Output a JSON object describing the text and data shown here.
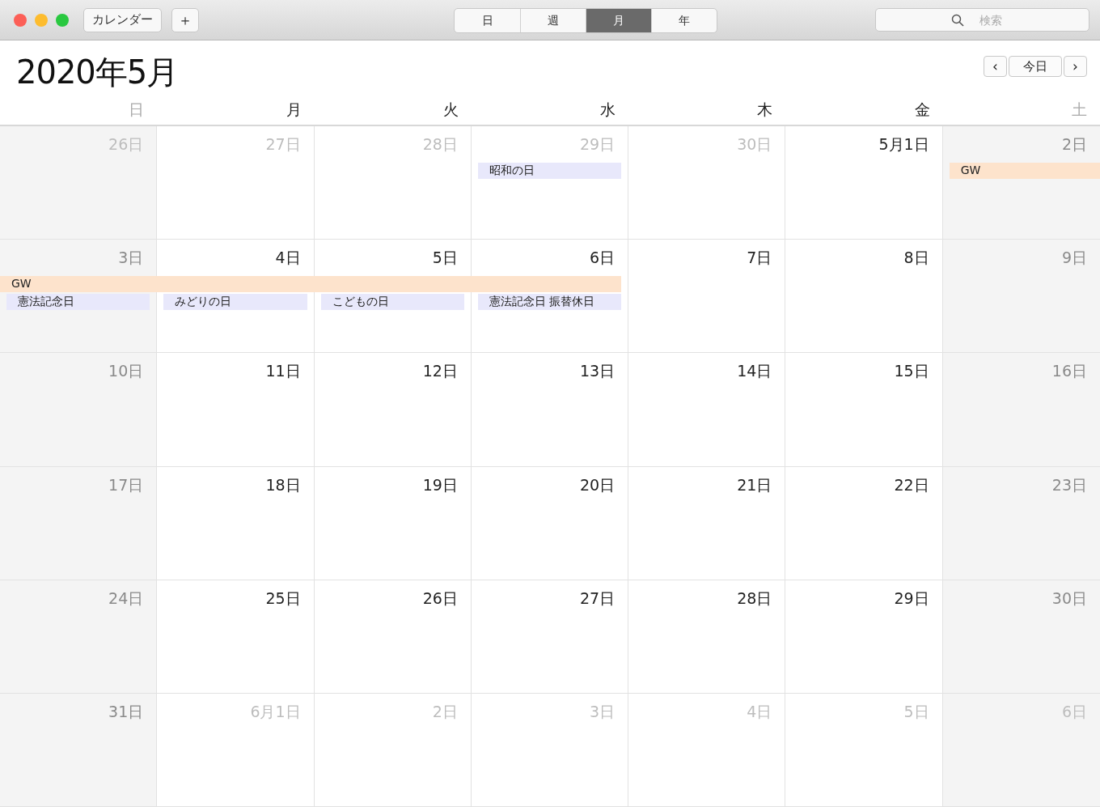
{
  "toolbar": {
    "calendars_button": "カレンダー",
    "add_button": "＋",
    "views": [
      {
        "label": "日",
        "selected": false
      },
      {
        "label": "週",
        "selected": false
      },
      {
        "label": "月",
        "selected": true
      },
      {
        "label": "年",
        "selected": false
      }
    ],
    "search": {
      "placeholder": "検索"
    }
  },
  "title": "2020年5月",
  "nav": {
    "prev": "‹",
    "today": "今日",
    "next": "›"
  },
  "weekdays": [
    "日",
    "月",
    "火",
    "水",
    "木",
    "金",
    "土"
  ],
  "weeks": [
    {
      "days": [
        {
          "label": "26日",
          "in_month": false
        },
        {
          "label": "27日",
          "in_month": false
        },
        {
          "label": "28日",
          "in_month": false
        },
        {
          "label": "29日",
          "in_month": false,
          "events": [
            {
              "kind": "single",
              "title": "昭和の日",
              "color": "#e8e8fb"
            }
          ]
        },
        {
          "label": "30日",
          "in_month": false
        },
        {
          "label": "5月1日",
          "in_month": true
        },
        {
          "label": "2日",
          "in_month": true,
          "events": [
            {
              "kind": "begin",
              "title": "GW",
              "color": "#fde3cc"
            }
          ]
        }
      ]
    },
    {
      "days": [
        {
          "label": "3日",
          "in_month": true,
          "events": [
            {
              "kind": "middle",
              "title": "GW",
              "color": "#fde3cc"
            },
            {
              "kind": "single",
              "title": "憲法記念日",
              "color": "#e8e8fb"
            }
          ]
        },
        {
          "label": "4日",
          "in_month": true,
          "events": [
            {
              "kind": "middle"
            },
            {
              "kind": "single",
              "title": "みどりの日",
              "color": "#e8e8fb"
            }
          ]
        },
        {
          "label": "5日",
          "in_month": true,
          "events": [
            {
              "kind": "middle"
            },
            {
              "kind": "single",
              "title": "こどもの日",
              "color": "#e8e8fb"
            }
          ]
        },
        {
          "label": "6日",
          "in_month": true,
          "events": [
            {
              "kind": "end"
            },
            {
              "kind": "single",
              "title": "憲法記念日 振替休日",
              "color": "#e8e8fb"
            }
          ]
        },
        {
          "label": "7日",
          "in_month": true
        },
        {
          "label": "8日",
          "in_month": true
        },
        {
          "label": "9日",
          "in_month": true
        }
      ]
    },
    {
      "days": [
        {
          "label": "10日",
          "in_month": true
        },
        {
          "label": "11日",
          "in_month": true
        },
        {
          "label": "12日",
          "in_month": true
        },
        {
          "label": "13日",
          "in_month": true
        },
        {
          "label": "14日",
          "in_month": true
        },
        {
          "label": "15日",
          "in_month": true
        },
        {
          "label": "16日",
          "in_month": true
        }
      ]
    },
    {
      "days": [
        {
          "label": "17日",
          "in_month": true
        },
        {
          "label": "18日",
          "in_month": true
        },
        {
          "label": "19日",
          "in_month": true
        },
        {
          "label": "20日",
          "in_month": true
        },
        {
          "label": "21日",
          "in_month": true
        },
        {
          "label": "22日",
          "in_month": true
        },
        {
          "label": "23日",
          "in_month": true
        }
      ]
    },
    {
      "days": [
        {
          "label": "24日",
          "in_month": true
        },
        {
          "label": "25日",
          "in_month": true
        },
        {
          "label": "26日",
          "in_month": true
        },
        {
          "label": "27日",
          "in_month": true
        },
        {
          "label": "28日",
          "in_month": true
        },
        {
          "label": "29日",
          "in_month": true
        },
        {
          "label": "30日",
          "in_month": true
        }
      ]
    },
    {
      "days": [
        {
          "label": "31日",
          "in_month": true
        },
        {
          "label": "6月1日",
          "in_month": false
        },
        {
          "label": "2日",
          "in_month": false
        },
        {
          "label": "3日",
          "in_month": false
        },
        {
          "label": "4日",
          "in_month": false
        },
        {
          "label": "5日",
          "in_month": false
        },
        {
          "label": "6日",
          "in_month": false
        }
      ]
    }
  ]
}
